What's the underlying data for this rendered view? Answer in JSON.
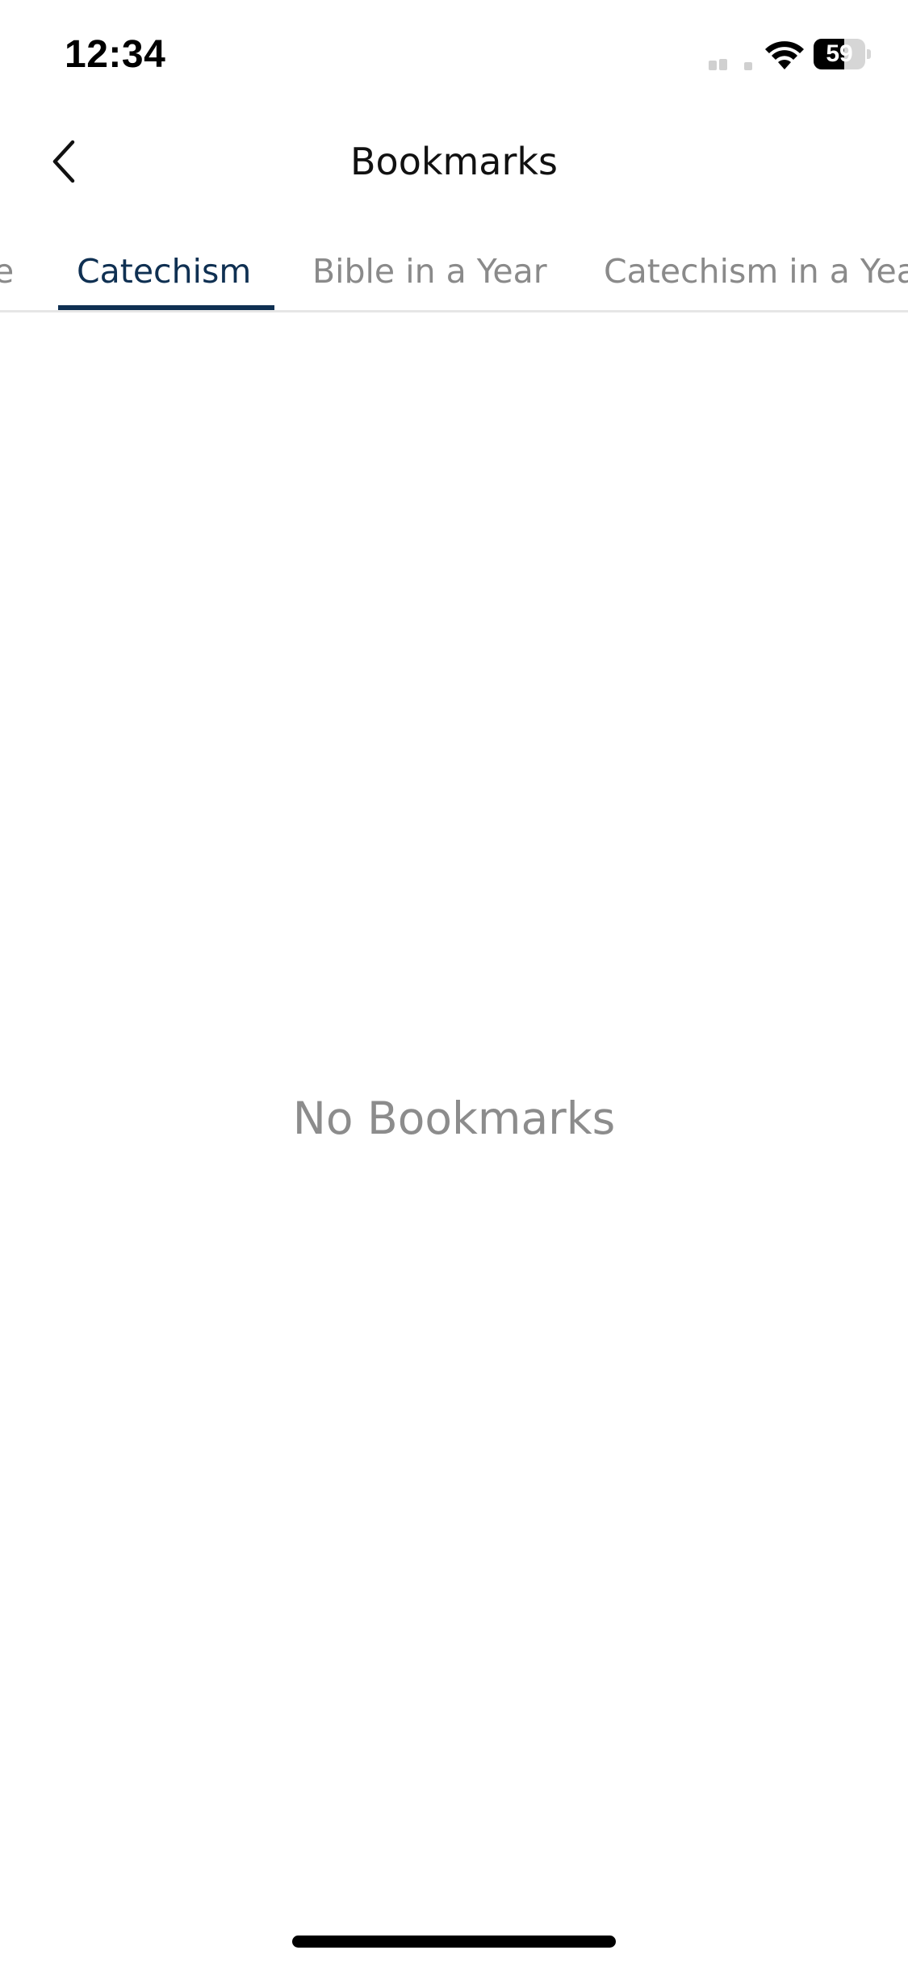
{
  "status_bar": {
    "time": "12:34",
    "battery_percent": 59,
    "battery_label": "59",
    "icons": [
      "signal-icon",
      "wifi-icon",
      "battery-icon"
    ]
  },
  "nav": {
    "title": "Bookmarks",
    "back_icon": "chevron-left-icon"
  },
  "tabs": [
    {
      "label": "e",
      "active": false
    },
    {
      "label": "Catechism",
      "active": true
    },
    {
      "label": "Bible in a Year",
      "active": false
    },
    {
      "label": "Catechism in a Yea",
      "active": false
    }
  ],
  "colors": {
    "active_tab": "#0f3052",
    "inactive_tab": "#8a8a8a",
    "empty_text": "#8c8c8c"
  },
  "empty_state": {
    "message": "No Bookmarks"
  }
}
